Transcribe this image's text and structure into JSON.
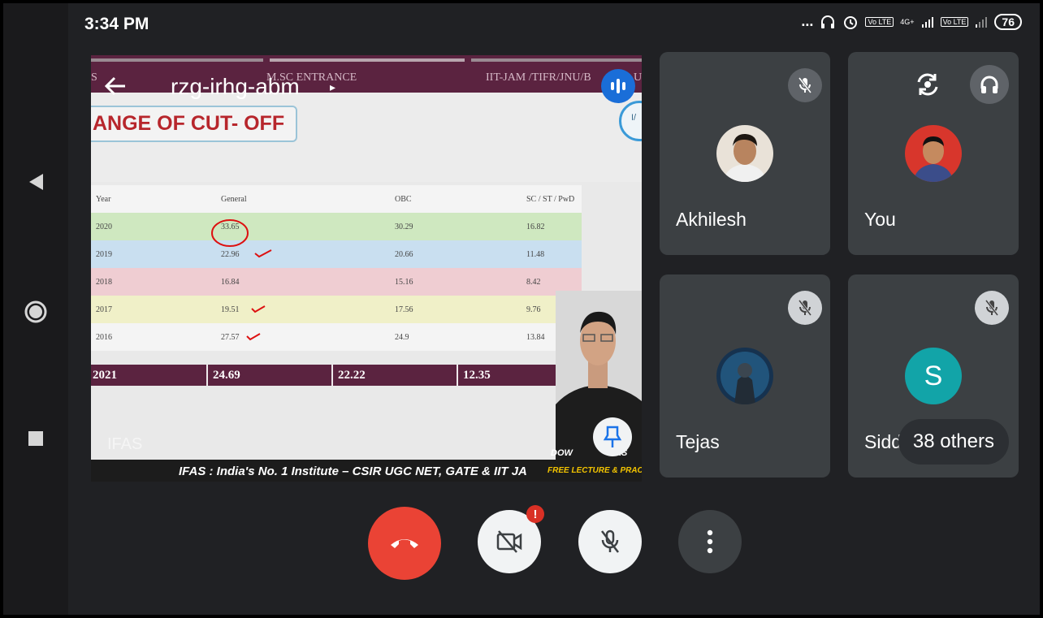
{
  "status_bar": {
    "time": "3:34 PM",
    "more_dots": "...",
    "volte1": "Vo LTE",
    "net_type": "4G+",
    "volte2": "Vo LTE",
    "battery": "76"
  },
  "nav": {
    "back": "back",
    "home": "home",
    "recents": "recents"
  },
  "meeting": {
    "code": "rzg-irhg-abm",
    "code_caret": "▸"
  },
  "slide": {
    "band_left": "S",
    "band_center": "M.SC ENTRANCE",
    "band_right": "IIT-JAM /TIFR/JNU/B",
    "band_right_tail": "U",
    "title": "ANGE OF CUT- OFF",
    "headers": [
      "Year",
      "General",
      "OBC",
      "SC / ST / PwD"
    ],
    "rows": [
      [
        "2020",
        "33.65",
        "30.29",
        "16.82"
      ],
      [
        "2019",
        "22.96",
        "20.66",
        "11.48"
      ],
      [
        "2018",
        "16.84",
        "15.16",
        "8.42"
      ],
      [
        "2017",
        "19.51",
        "17.56",
        "9.76"
      ],
      [
        "2016",
        "27.57",
        "24.9",
        "13.84"
      ]
    ],
    "row_colors": [
      "#f4f4f4",
      "#cfe8c0",
      "#c9dff0",
      "#efcdd2",
      "#f0f0c8",
      "#f4f4f4"
    ],
    "highlight": [
      "2021",
      "24.69",
      "22.22",
      "12.35"
    ],
    "logo": "IFAS",
    "ticker_main": "IFAS : India's No. 1 Institute – CSIR UGC NET, GATE & IIT JA",
    "ticker_side": "FREE LECTURE & PRACTICE",
    "download_text": "DOW",
    "download_tail": "FAS",
    "ifas_circle_text": "I/"
  },
  "participants": [
    {
      "name": "Akhilesh",
      "muted": true
    },
    {
      "name": "You",
      "muted": false
    },
    {
      "name": "Tejas",
      "muted": true
    },
    {
      "name": "Sidd",
      "initial": "S",
      "muted": true
    }
  ],
  "others_label": "38 others",
  "controls": {
    "end_call": "end-call",
    "camera_badge": "!",
    "mic": "mic-off",
    "more": "more-options"
  },
  "colors": {
    "end_call": "#ea4335",
    "tile_bg": "#3c4043",
    "accent_blue": "#1a6ed8",
    "avatar_teal": "#12a4a8",
    "slide_band": "#5b2340"
  }
}
